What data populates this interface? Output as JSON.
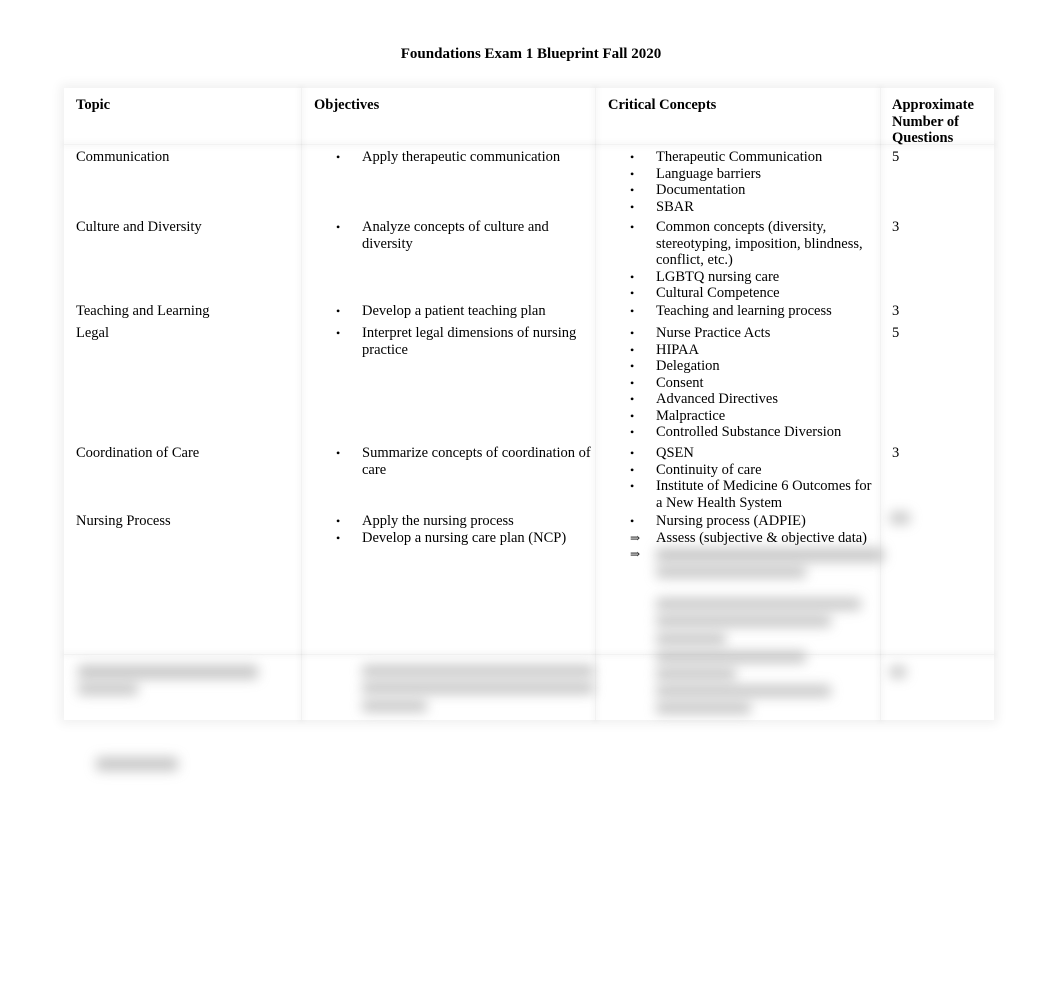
{
  "title": "Foundations Exam 1 Blueprint Fall 2020",
  "headers": {
    "topic": "Topic",
    "objectives": "Objectives",
    "concepts": "Critical Concepts",
    "count": "Approximate Number of Questions"
  },
  "rows": [
    {
      "topic": "Communication",
      "objectives": [
        "Apply therapeutic communication"
      ],
      "concepts": [
        "Therapeutic Communication",
        "Language barriers",
        "Documentation",
        "SBAR"
      ],
      "count": "5"
    },
    {
      "topic": "Culture and Diversity",
      "objectives": [
        "Analyze concepts of culture and diversity"
      ],
      "concepts": [
        "Common concepts (diversity, stereotyping, imposition, blindness, conflict, etc.)",
        "LGBTQ nursing care",
        "Cultural Competence"
      ],
      "count": "3"
    },
    {
      "topic": "Teaching and Learning",
      "objectives": [
        "Develop a patient teaching plan"
      ],
      "concepts": [
        "Teaching and learning process"
      ],
      "count": "3"
    },
    {
      "topic": "Legal",
      "objectives": [
        "Interpret legal dimensions of nursing practice"
      ],
      "concepts": [
        "Nurse Practice Acts",
        "HIPAA",
        "Delegation",
        "Consent",
        "Advanced Directives",
        "Malpractice",
        "Controlled Substance Diversion"
      ],
      "count": "5"
    },
    {
      "topic": "Coordination of Care",
      "objectives": [
        "Summarize concepts of coordination of care"
      ],
      "concepts": [
        "QSEN",
        "Continuity of care",
        "Institute of Medicine 6 Outcomes for a New Health System"
      ],
      "count": "3"
    },
    {
      "topic": "Nursing Process",
      "objectives": [
        "Apply the nursing process",
        "Develop a nursing care plan (NCP)"
      ],
      "concepts": [
        "Nursing process (ADPIE)",
        "Assess (subjective & objective data)"
      ],
      "count": ""
    }
  ],
  "markers": {
    "bullet": "•",
    "arrow": "⇒"
  }
}
